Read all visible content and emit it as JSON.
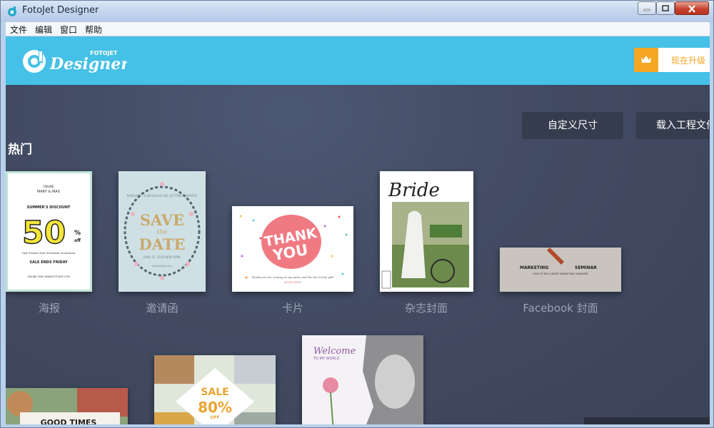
{
  "window": {
    "title": "FotoJet Designer"
  },
  "menu": {
    "items": [
      "文件",
      "编辑",
      "窗口",
      "帮助"
    ]
  },
  "header": {
    "logo_small": "FOTOJET",
    "logo_main": "Designer",
    "upgrade_label": "现在升级"
  },
  "toolbar": {
    "custom_size": "自定义尺寸",
    "load_project": "载入工程文件"
  },
  "section": {
    "title": "热门"
  },
  "templates": [
    {
      "label": "海报"
    },
    {
      "label": "邀请函"
    },
    {
      "label": "卡片"
    },
    {
      "label": "杂志封面"
    },
    {
      "label": "Facebook 封面"
    }
  ],
  "thumbs": {
    "poster": {
      "line1": "ONLINE",
      "line2": "MARY & MAX",
      "line3": "SUMMER'S DISCOUNT",
      "big": "50",
      "pct": "%",
      "off": "off",
      "cats": "Coat   Trousers   Skirt   Underwear   Accessories",
      "ends": "SALE ENDS FRIDAY",
      "url": "ONLINE ONLY WWW.FOTOJET.COM"
    },
    "invite": {
      "top": "MARGARET & NICHOLAS ARE GETTING MARRIED!",
      "save": "SAVE",
      "the": "the",
      "date": "DATE",
      "when": "JUNE 23, 2016   NEW YORK",
      "site": "www.fotojet.com"
    },
    "card": {
      "thank": "THANK",
      "you": "YOU",
      "msg": "Thank you for coming to my party and for the lovely gift!",
      "sign": "ROSE KATE"
    },
    "mag": {
      "title": "Bride"
    },
    "fb": {
      "l": "MARKETING",
      "r": "SEMINAR",
      "sub": "HOW TO BE A GREAT MARKETING MANAGER"
    },
    "r1": {
      "text": "GOOD TIMES"
    },
    "r2": {
      "sale": "SALE",
      "pct": "80%",
      "off": "OFF"
    },
    "r3": {
      "welcome": "Welcome",
      "to": "TO MY WORLD"
    }
  }
}
